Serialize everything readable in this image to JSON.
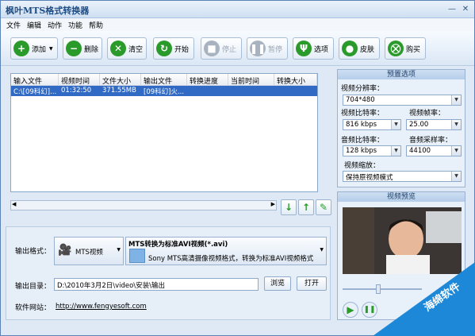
{
  "window": {
    "title": "枫叶MTS格式转换器",
    "minimize": "—",
    "close": "✕"
  },
  "menu": [
    "文件",
    "编辑",
    "动作",
    "功能",
    "帮助"
  ],
  "toolbar": {
    "add": "添加",
    "remove": "删除",
    "clear": "清空",
    "start": "开始",
    "stop": "停止",
    "pause": "暂停",
    "options": "选项",
    "skin": "皮肤",
    "buy": "购买"
  },
  "table": {
    "headers": [
      "输入文件",
      "视频时间",
      "文件大小",
      "输出文件",
      "转换进度",
      "当前时间",
      "转换大小"
    ],
    "rows": [
      {
        "input": "C:\\[09科幻]...",
        "duration": "01:32:50",
        "size": "371.55MB",
        "output": "[09科幻]火...",
        "progress": "",
        "current": "",
        "converted": ""
      }
    ]
  },
  "preset": {
    "title": "预置选项",
    "resolution_label": "视频分辨率：",
    "resolution_value": "704*480",
    "vbitrate_label": "视频比特率：",
    "vbitrate_value": "816 kbps",
    "fps_label": "视频帧率：",
    "fps_value": "25.00",
    "abitrate_label": "音频比特率：",
    "abitrate_value": "128 kbps",
    "samplerate_label": "音频采样率：",
    "samplerate_value": "44100",
    "zoom_label": "视频缩放：",
    "zoom_value": "保持原视频模式"
  },
  "preview": {
    "title": "视频预览"
  },
  "output": {
    "format_label": "输出格式：",
    "format_device": "MTS视频",
    "format_title": "MTS转换为标准AVI视频(*.avi)",
    "format_desc": "Sony MTS高清摄像视频格式，转换为标准AVI视频格式",
    "dir_label": "输出目录：",
    "dir_value": "D:\\2010年3月2日\\video\\安装\\输出",
    "browse": "浏览",
    "open": "打开",
    "site_label": "软件网站：",
    "site_url": "http://www.fengyesoft.com"
  },
  "watermark": "海绵软件",
  "colors": {
    "accent": "#316ac5",
    "watermark": "#1e88d8"
  }
}
